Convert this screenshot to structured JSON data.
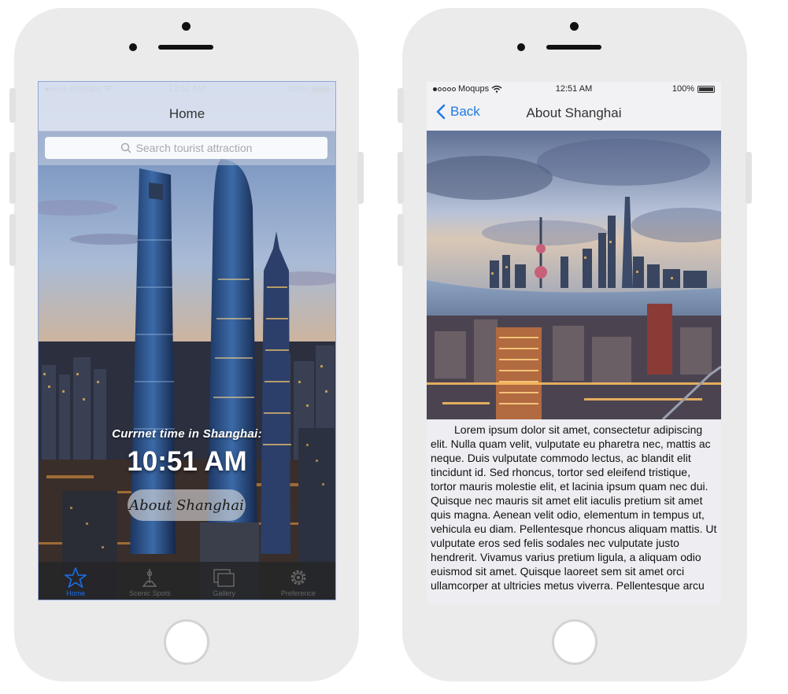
{
  "status_bar": {
    "carrier": "Moqups",
    "time": "12:51 AM",
    "battery": "100%"
  },
  "home_screen": {
    "title": "Home",
    "search": {
      "placeholder": "Search tourist attraction",
      "value": ""
    },
    "time_label": "Currnet time in Shanghai:",
    "time_value": "10:51 AM",
    "about_button": "About Shanghai",
    "tabs": [
      {
        "label": "Home",
        "icon": "star-icon",
        "active": true
      },
      {
        "label": "Scenic Spots",
        "icon": "monument-icon",
        "active": false
      },
      {
        "label": "Gallery",
        "icon": "gallery-icon",
        "active": false
      },
      {
        "label": "Preference",
        "icon": "gear-icon",
        "active": false
      }
    ]
  },
  "about_screen": {
    "back_label": "Back",
    "title": "About Shanghai",
    "body": "Lorem ipsum dolor sit amet, consectetur adipiscing elit. Nulla quam velit, vulputate eu pharetra nec, mattis ac neque. Duis vulputate commodo lectus, ac blandit elit tincidunt id. Sed rhoncus, tortor sed eleifend tristique, tortor mauris molestie elit, et lacinia ipsum quam nec dui. Quisque nec mauris sit amet elit iaculis pretium sit amet quis magna. Aenean velit odio, elementum in tempus ut, vehicula eu diam. Pellentesque rhoncus aliquam mattis. Ut vulputate eros sed felis sodales nec vulputate justo hendrerit. Vivamus varius pretium ligula, a aliquam odio euismod sit amet. Quisque laoreet sem sit amet orci ullamcorper at ultricies metus viverra. Pellentesque arcu"
  },
  "colors": {
    "accent": "#1f7ae0",
    "tab_active": "#1a6ee8",
    "phone_body": "#ebebeb"
  }
}
